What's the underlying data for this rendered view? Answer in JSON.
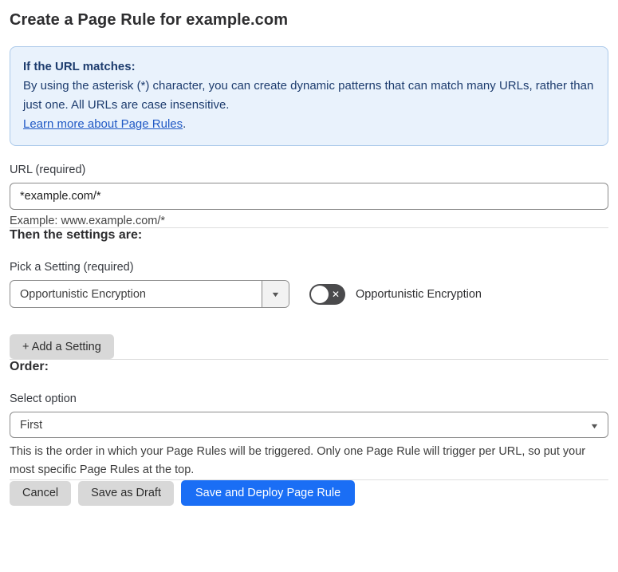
{
  "page": {
    "title": "Create a Page Rule for example.com"
  },
  "info_box": {
    "heading": "If the URL matches:",
    "body": "By using the asterisk (*) character, you can create dynamic patterns that can match many URLs, rather than just one. All URLs are case insensitive.",
    "link_label": "Learn more about Page Rules",
    "link_suffix": "."
  },
  "url_field": {
    "label": "URL (required)",
    "value": "*example.com/*",
    "example": "Example: www.example.com/*"
  },
  "settings_section": {
    "heading": "Then the settings are:",
    "picker_label": "Pick a Setting (required)",
    "picker_value": "Opportunistic Encryption",
    "toggle_state": "off",
    "toggle_label": "Opportunistic Encryption",
    "add_button_label": "+ Add a Setting"
  },
  "order_section": {
    "heading": "Order:",
    "select_label": "Select option",
    "select_value": "First",
    "description": "This is the order in which your Page Rules will be triggered. Only one Page Rule will trigger per URL, so put your most specific Page Rules at the top."
  },
  "footer": {
    "cancel_label": "Cancel",
    "save_draft_label": "Save as Draft",
    "deploy_label": "Save and Deploy Page Rule"
  },
  "icons": {
    "dropdown_arrow": "▼",
    "toggle_x": "✕"
  },
  "colors": {
    "accent_blue": "#1a6ef5",
    "info_background": "#e9f2fc",
    "info_border": "#abc9ea",
    "info_text": "#1d3c6e",
    "link_blue": "#2059c5",
    "toggle_off_background": "#4a4a4c",
    "button_gray": "#d8d8d8",
    "input_border": "#8b8b8b"
  }
}
